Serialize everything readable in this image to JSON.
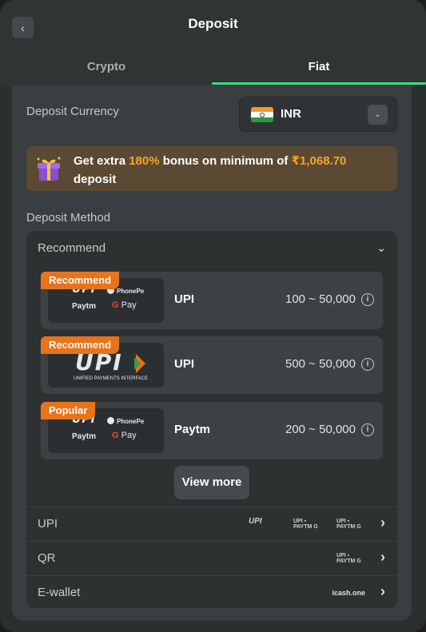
{
  "header": {
    "title": "Deposit",
    "back_icon": "chevron-left-icon",
    "tabs": [
      {
        "label": "Crypto",
        "active": false
      },
      {
        "label": "Fiat",
        "active": true
      }
    ],
    "accent_color": "#3ddc84"
  },
  "currency": {
    "label": "Deposit Currency",
    "selected": "INR",
    "flag": "india-flag-icon"
  },
  "bonus": {
    "prefix": "Get extra ",
    "percent": "180%",
    "middle": " bonus on minimum of ",
    "amount": "₹1,068.70",
    "suffix": "deposit",
    "highlight_color": "#f5a623"
  },
  "method": {
    "label": "Deposit Method",
    "recommend_title": "Recommend",
    "cards": [
      {
        "badge": "Recommend",
        "name": "UPI",
        "range": "100 ~ 50,000",
        "logos": [
          "UPI",
          "PhonePe",
          "Paytm",
          "G Pay"
        ]
      },
      {
        "badge": "Recommend",
        "name": "UPI",
        "range": "500 ~ 50,000",
        "logos": [
          "UPI",
          "UNIFIED PAYMENTS INTERFACE"
        ]
      },
      {
        "badge": "Popular",
        "name": "Paytm",
        "range": "200 ~ 50,000",
        "logos": [
          "UPI",
          "PhonePe",
          "Paytm",
          "G Pay"
        ]
      }
    ],
    "view_more": "View more",
    "rows": [
      {
        "label": "UPI"
      },
      {
        "label": "QR"
      },
      {
        "label": "E-wallet",
        "logo": "icash.one"
      }
    ]
  }
}
